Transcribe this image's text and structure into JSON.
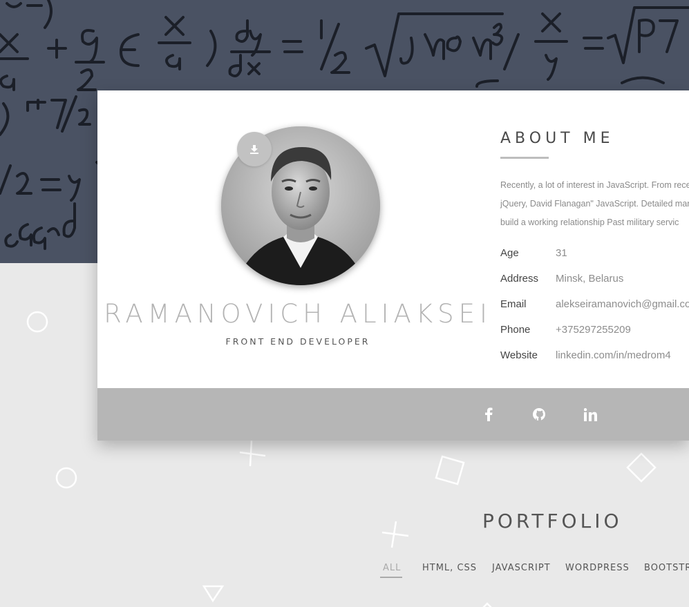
{
  "hero": {
    "formula_line1": "x/a + 9/2 ∈ x/a ) dy/dx = ½ √ʃnon³ / x/y = √P7",
    "formula_line2": "3)-7/10",
    "formula_line3": "/2 = y",
    "formula_line4": "ead"
  },
  "profile": {
    "name": "RAMANOVICH ALIAKSEI",
    "role": "FRONT END DEVELOPER",
    "download_icon": "download-icon"
  },
  "about": {
    "title": "ABOUT ME",
    "text_lines": [
      "Recently, a lot of interest in JavaScript. From rece",
      "jQuery, David Flanagan\" JavaScript. Detailed mar",
      "build a working relationship Past military servic"
    ],
    "info": [
      {
        "label": "Age",
        "value": "31"
      },
      {
        "label": "Address",
        "value": "Minsk, Belarus"
      },
      {
        "label": "Email",
        "value": "alekseiramanovich@gmail.com"
      },
      {
        "label": "Phone",
        "value": "+375297255209"
      },
      {
        "label": "Website",
        "value": "linkedin.com/in/medrom4"
      }
    ]
  },
  "social": {
    "icons": [
      "facebook-icon",
      "github-icon",
      "linkedin-icon"
    ]
  },
  "portfolio": {
    "title": "PORTFOLIO",
    "filters": [
      "ALL",
      "HTML, CSS",
      "JAVASCRIPT",
      "WORDPRESS",
      "BOOTSTRA"
    ],
    "active_filter": "ALL"
  },
  "colors": {
    "hero_bg": "#4d5566",
    "page_bg": "#e9e9e9",
    "card_bg": "#ffffff",
    "social_bar": "#b6b6b6",
    "name_color": "#b3b3b3"
  }
}
